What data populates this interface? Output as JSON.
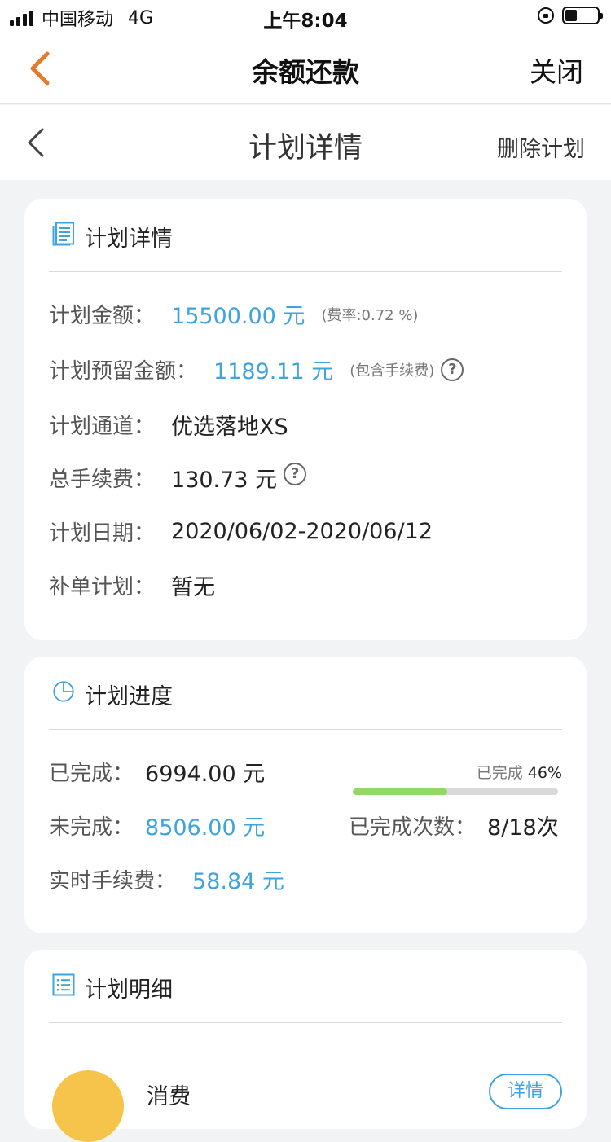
{
  "status_bar": {
    "carrier": "中国移动",
    "network": "4G",
    "time": "上午8:04"
  },
  "nav_primary": {
    "title": "余额还款",
    "close_label": "关闭"
  },
  "nav_secondary": {
    "title": "计划详情",
    "delete_label": "删除计划"
  },
  "plan_details": {
    "heading": "计划详情",
    "amount_label": "计划金额：",
    "amount_value": "15500.00 元",
    "rate_note": "(费率:0.72 %)",
    "reserve_label": "计划预留金额：",
    "reserve_value": "1189.11 元",
    "reserve_note": "(包含手续费)",
    "channel_label": "计划通道：",
    "channel_value": "优选落地XS",
    "fee_label": "总手续费：",
    "fee_value": "130.73 元",
    "date_label": "计划日期：",
    "date_value": "2020/06/02-2020/06/12",
    "supplement_label": "补单计划：",
    "supplement_value": "暂无"
  },
  "plan_progress": {
    "heading": "计划进度",
    "done_label": "已完成：",
    "done_value": "6994.00 元",
    "undone_label": "未完成：",
    "undone_value": "8506.00 元",
    "realtime_fee_label": "实时手续费：",
    "realtime_fee_value": "58.84 元",
    "progress_caption": "已完成",
    "progress_percent_text": "46%",
    "progress_fraction": 0.46,
    "count_label": "已完成次数：",
    "count_value": "8/18次"
  },
  "plan_items": {
    "heading": "计划明细",
    "first_item_type": "消费",
    "detail_button": "详情"
  },
  "colors": {
    "accent_blue": "#3fa3de",
    "back_orange": "#e8782a",
    "progress_green": "#8fd96a"
  }
}
